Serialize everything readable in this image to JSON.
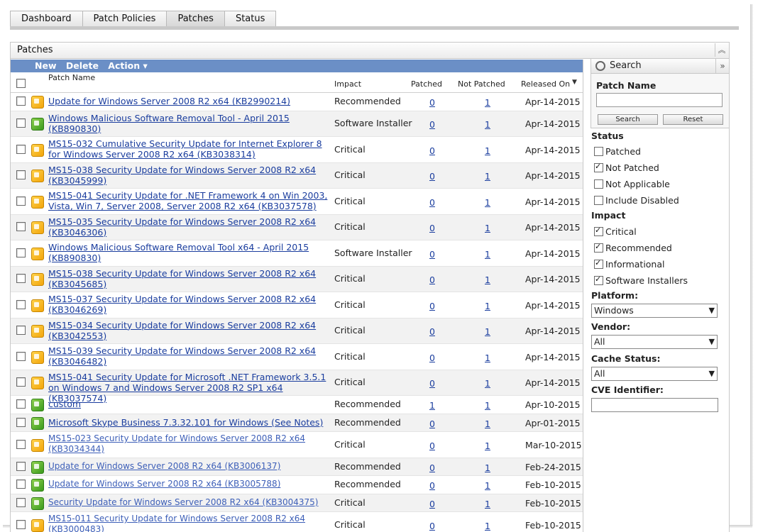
{
  "tabs": [
    {
      "label": "Dashboard",
      "active": false
    },
    {
      "label": "Patch Policies",
      "active": false
    },
    {
      "label": "Patches",
      "active": true
    },
    {
      "label": "Status",
      "active": false
    }
  ],
  "panel": {
    "title": "Patches"
  },
  "toolbar": {
    "new": "New",
    "delete": "Delete",
    "action": "Action ▾"
  },
  "columns": {
    "patch_name": "Patch Name",
    "impact": "Impact",
    "patched": "Patched",
    "not_patched": "Not Patched",
    "released_on": "Released On"
  },
  "rows": [
    {
      "name": "Update for Windows Server 2008 R2 x64 (KB2990214)",
      "icon": "yellow",
      "impact": "Recommended",
      "patched": "0",
      "not_patched": "1",
      "released": "Apr-14-2015",
      "lines": 1,
      "style": "bold"
    },
    {
      "name": "Windows Malicious Software Removal Tool - April 2015 (KB890830)",
      "icon": "green",
      "impact": "Software Installer",
      "patched": "0",
      "not_patched": "1",
      "released": "Apr-14-2015",
      "lines": 2,
      "style": "bold"
    },
    {
      "name": "MS15-032 Cumulative Security Update for Internet Explorer 8 for Windows Server 2008 R2 x64 (KB3038314)",
      "icon": "yellow",
      "impact": "Critical",
      "patched": "0",
      "not_patched": "1",
      "released": "Apr-14-2015",
      "lines": 2,
      "style": "bold"
    },
    {
      "name": "MS15-038 Security Update for Windows Server 2008 R2 x64 (KB3045999)",
      "icon": "yellow",
      "impact": "Critical",
      "patched": "0",
      "not_patched": "1",
      "released": "Apr-14-2015",
      "lines": 2,
      "style": "bold"
    },
    {
      "name": "MS15-041 Security Update for .NET Framework 4 on Win 2003, Vista, Win 7, Server 2008, Server 2008 R2 x64 (KB3037578)",
      "icon": "yellow",
      "impact": "Critical",
      "patched": "0",
      "not_patched": "1",
      "released": "Apr-14-2015",
      "lines": 2,
      "style": "bold"
    },
    {
      "name": "MS15-035 Security Update for Windows Server 2008 R2 x64 (KB3046306)",
      "icon": "yellow",
      "impact": "Critical",
      "patched": "0",
      "not_patched": "1",
      "released": "Apr-14-2015",
      "lines": 2,
      "style": "bold"
    },
    {
      "name": "Windows Malicious Software Removal Tool x64 - April 2015 (KB890830)",
      "icon": "yellow",
      "impact": "Software Installer",
      "patched": "0",
      "not_patched": "1",
      "released": "Apr-14-2015",
      "lines": 2,
      "style": "bold"
    },
    {
      "name": "MS15-038 Security Update for Windows Server 2008 R2 x64 (KB3045685)",
      "icon": "yellow",
      "impact": "Critical",
      "patched": "0",
      "not_patched": "1",
      "released": "Apr-14-2015",
      "lines": 2,
      "style": "bold"
    },
    {
      "name": "MS15-037 Security Update for Windows Server 2008 R2 x64 (KB3046269)",
      "icon": "yellow",
      "impact": "Critical",
      "patched": "0",
      "not_patched": "1",
      "released": "Apr-14-2015",
      "lines": 2,
      "style": "bold"
    },
    {
      "name": "MS15-034 Security Update for Windows Server 2008 R2 x64 (KB3042553)",
      "icon": "yellow",
      "impact": "Critical",
      "patched": "0",
      "not_patched": "1",
      "released": "Apr-14-2015",
      "lines": 2,
      "style": "bold"
    },
    {
      "name": "MS15-039 Security Update for Windows Server 2008 R2 x64 (KB3046482)",
      "icon": "yellow",
      "impact": "Critical",
      "patched": "0",
      "not_patched": "1",
      "released": "Apr-14-2015",
      "lines": 2,
      "style": "bold"
    },
    {
      "name": "MS15-041 Security Update for Microsoft .NET Framework 3.5.1 on Windows 7 and Windows Server 2008 R2 SP1 x64 (KB3037574)",
      "icon": "yellow",
      "impact": "Critical",
      "patched": "0",
      "not_patched": "1",
      "released": "Apr-14-2015",
      "lines": 2,
      "style": "bold"
    },
    {
      "name": "custom",
      "icon": "green",
      "impact": "Recommended",
      "patched": "1",
      "not_patched": "1",
      "released": "Apr-10-2015",
      "lines": 1,
      "style": "bold"
    },
    {
      "name": "Microsoft Skype Business 7.3.32.101 for Windows (See Notes)",
      "icon": "green",
      "impact": "Recommended",
      "patched": "0",
      "not_patched": "1",
      "released": "Apr-01-2015",
      "lines": 1,
      "style": "bold"
    },
    {
      "name": "MS15-023 Security Update for Windows Server 2008 R2 x64 (KB3034344)",
      "icon": "yellow",
      "impact": "Critical",
      "patched": "0",
      "not_patched": "1",
      "released": "Mar-10-2015",
      "lines": 2,
      "style": "light"
    },
    {
      "name": "Update for Windows Server 2008 R2 x64 (KB3006137)",
      "icon": "green",
      "impact": "Recommended",
      "patched": "0",
      "not_patched": "1",
      "released": "Feb-24-2015",
      "lines": 1,
      "style": "light"
    },
    {
      "name": "Update for Windows Server 2008 R2 x64 (KB3005788)",
      "icon": "green",
      "impact": "Recommended",
      "patched": "0",
      "not_patched": "1",
      "released": "Feb-10-2015",
      "lines": 1,
      "style": "light"
    },
    {
      "name": "Security Update for Windows Server 2008 R2 x64 (KB3004375)",
      "icon": "green",
      "impact": "Critical",
      "patched": "0",
      "not_patched": "1",
      "released": "Feb-10-2015",
      "lines": 1,
      "style": "light"
    },
    {
      "name": "MS15-011 Security Update for Windows Server 2008 R2 x64 (KB3000483)",
      "icon": "yellow",
      "impact": "Critical",
      "patched": "0",
      "not_patched": "1",
      "released": "Feb-10-2015",
      "lines": 2,
      "style": "light"
    }
  ],
  "search": {
    "title": "Search",
    "patch_name_label": "Patch Name",
    "patch_name_value": "",
    "search_button": "Search",
    "reset_button": "Reset",
    "status_label": "Status",
    "status_options": [
      {
        "label": "Patched",
        "checked": false
      },
      {
        "label": "Not Patched",
        "checked": true
      },
      {
        "label": "Not Applicable",
        "checked": false
      },
      {
        "label": "Include Disabled",
        "checked": false
      }
    ],
    "impact_label": "Impact",
    "impact_options": [
      {
        "label": "Critical",
        "checked": true
      },
      {
        "label": "Recommended",
        "checked": true
      },
      {
        "label": "Informational",
        "checked": true
      },
      {
        "label": "Software Installers",
        "checked": true
      }
    ],
    "platform_label": "Platform:",
    "platform_value": "Windows",
    "vendor_label": "Vendor:",
    "vendor_value": "All",
    "cache_label": "Cache Status:",
    "cache_value": "All",
    "cve_label": "CVE Identifier:",
    "cve_value": ""
  },
  "colors": {
    "toolbar": "#6b8fc6",
    "link": "#1a3d9e",
    "critical_icon": "#f2a50c",
    "installer_icon": "#3a9a1d"
  }
}
